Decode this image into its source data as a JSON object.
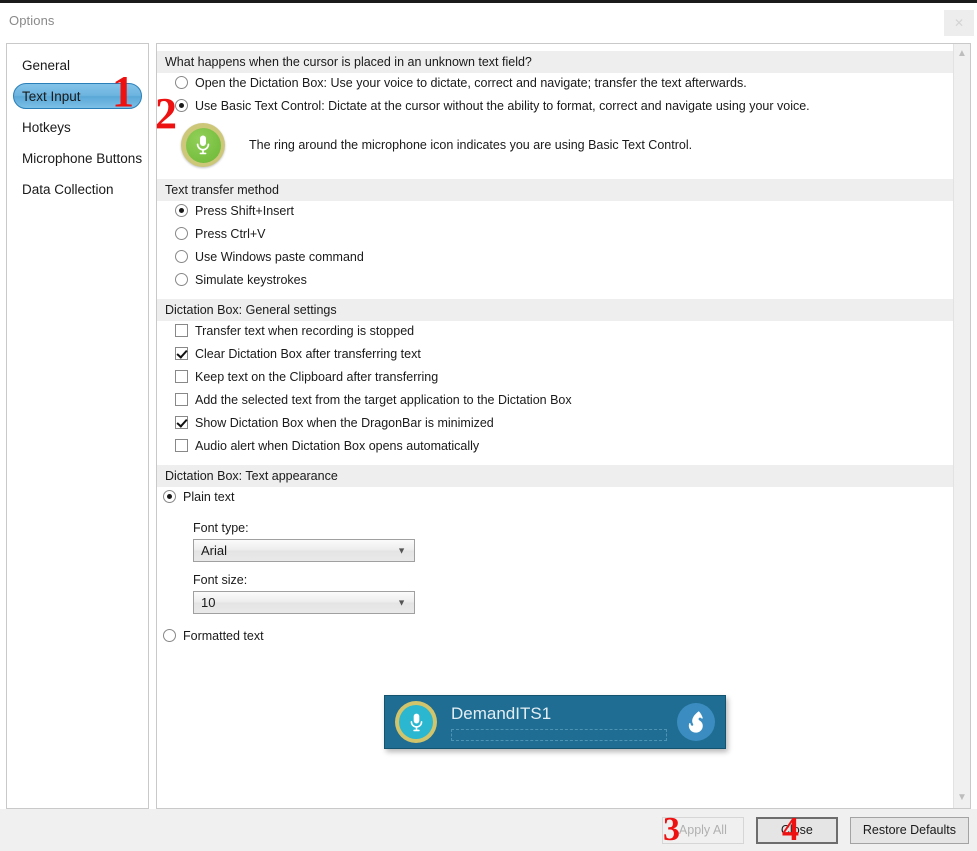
{
  "window": {
    "title": "Options",
    "close_icon": "x"
  },
  "sidebar": {
    "items": [
      {
        "label": "General",
        "selected": false
      },
      {
        "label": "Text Input",
        "selected": true
      },
      {
        "label": "Hotkeys",
        "selected": false
      },
      {
        "label": "Microphone Buttons",
        "selected": false
      },
      {
        "label": "Data Collection",
        "selected": false
      }
    ]
  },
  "sections": {
    "unknown_field": {
      "header": "What happens when the cursor is placed in an unknown text field?",
      "options": [
        {
          "label": "Open the Dictation Box: Use your voice to dictate, correct and navigate; transfer the text afterwards.",
          "checked": false
        },
        {
          "label": "Use Basic Text Control: Dictate at the cursor without the ability to format, correct and navigate using your voice.",
          "checked": true
        }
      ],
      "mic_note": "The ring around the microphone icon indicates you are using Basic Text Control."
    },
    "transfer_method": {
      "header": "Text transfer method",
      "options": [
        {
          "label": "Press Shift+Insert",
          "checked": true
        },
        {
          "label": "Press Ctrl+V",
          "checked": false
        },
        {
          "label": "Use Windows paste command",
          "checked": false
        },
        {
          "label": "Simulate keystrokes",
          "checked": false
        }
      ]
    },
    "general_settings": {
      "header": "Dictation Box: General settings",
      "options": [
        {
          "label": "Transfer text when recording is stopped",
          "checked": false
        },
        {
          "label": "Clear Dictation Box after transferring text",
          "checked": true
        },
        {
          "label": "Keep text on the Clipboard after transferring",
          "checked": false
        },
        {
          "label": "Add the selected text from the target application to the Dictation Box",
          "checked": false
        },
        {
          "label": "Show Dictation Box when the DragonBar is minimized",
          "checked": true
        },
        {
          "label": "Audio alert when Dictation Box opens automatically",
          "checked": false
        }
      ]
    },
    "text_appearance": {
      "header": "Dictation Box: Text appearance",
      "plain_text": {
        "label": "Plain text",
        "checked": true
      },
      "font_type_label": "Font type:",
      "font_type_value": "Arial",
      "font_size_label": "Font size:",
      "font_size_value": "10",
      "formatted_text": {
        "label": "Formatted text",
        "checked": false
      }
    }
  },
  "dragonbar": {
    "title": "DemandITS1",
    "mic_icon": "microphone-icon",
    "logo_icon": "dragon-flame-icon"
  },
  "footer": {
    "apply_all": "Apply All",
    "apply_all_disabled": true,
    "close": "Close",
    "restore_defaults": "Restore Defaults"
  },
  "annotations": {
    "one": "1",
    "two": "2",
    "three": "3",
    "four": "4"
  },
  "colors": {
    "selection_blue": "#6cb4e0",
    "annotation_red": "#ee1111",
    "section_header_bg": "#eeeeee",
    "dragonbar_bg": "#1f6d93",
    "mic_ring_gold": "#cdc77a",
    "mic_green": "#76bf3f",
    "dragonbar_mic_teal": "#2ab7cf"
  }
}
